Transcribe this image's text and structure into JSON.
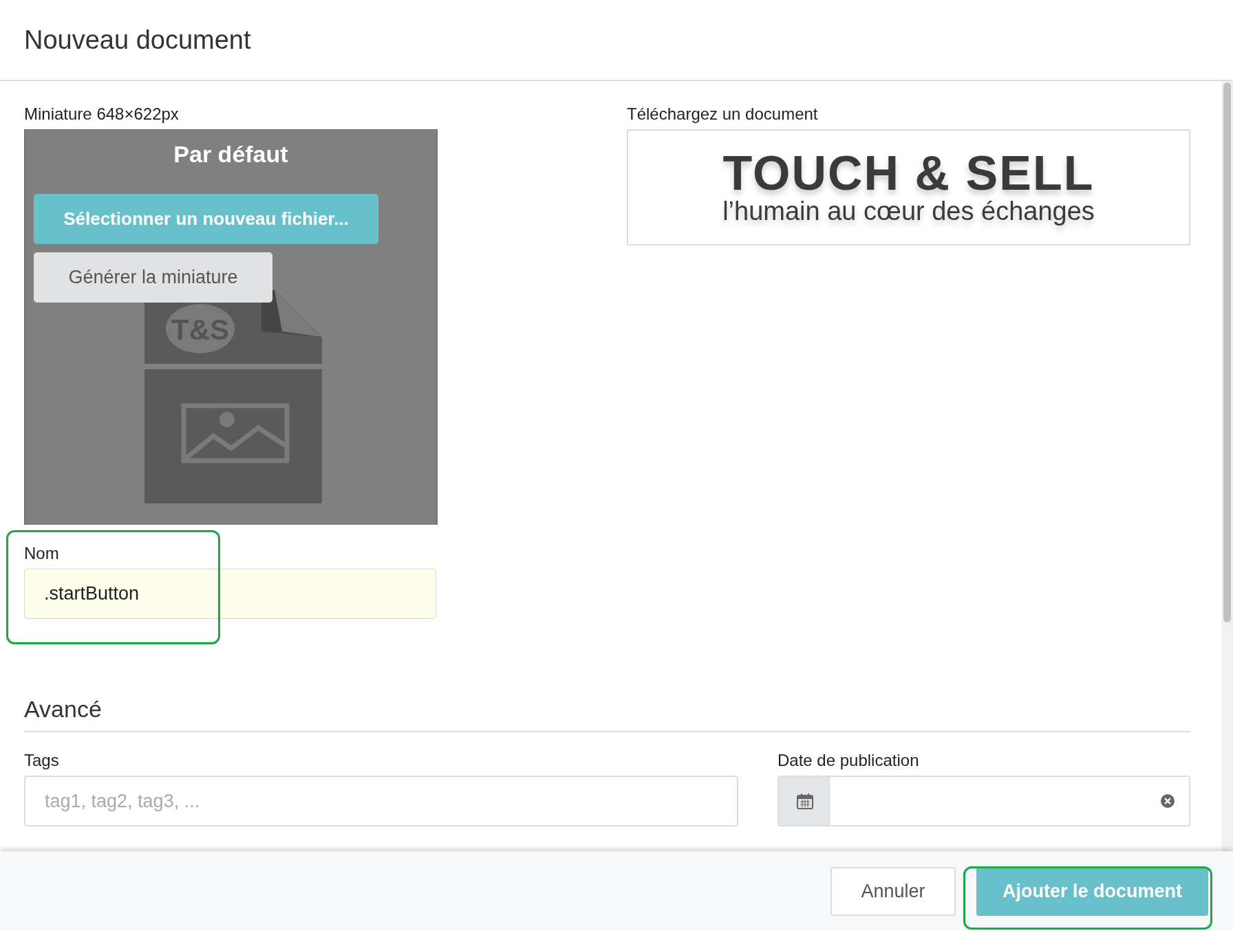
{
  "dialog": {
    "title": "Nouveau document"
  },
  "thumbnail": {
    "label": "Miniature 648×622px",
    "caption": "Par défaut",
    "select_button": "Sélectionner un nouveau fichier...",
    "generate_button": "Générer la miniature",
    "badge": "T&S"
  },
  "upload": {
    "label": "Téléchargez un document",
    "logo_title": "TOUCH & SELL",
    "logo_tagline": "l’humain au cœur des échanges"
  },
  "name_field": {
    "label": "Nom",
    "value": ".startButton"
  },
  "advanced": {
    "heading": "Avancé",
    "fields": [
      {
        "kind": "text",
        "label": "Tags",
        "placeholder": "tag1, tag2, tag3, ..."
      },
      {
        "kind": "date",
        "label": "Date de publication"
      }
    ]
  },
  "footer": {
    "buttons": [
      {
        "kind": "secondary",
        "label": "Annuler"
      },
      {
        "kind": "primary",
        "label": "Ajouter le document"
      }
    ]
  }
}
